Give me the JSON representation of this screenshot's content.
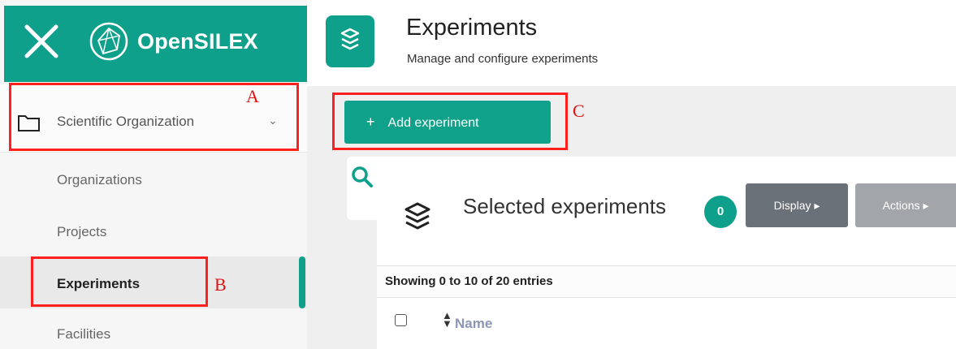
{
  "app": {
    "brand": "OpenSILEX"
  },
  "sidebar": {
    "items": [
      {
        "label": "Scientific Organization",
        "icon": "folder-icon"
      },
      {
        "label": "Organizations"
      },
      {
        "label": "Projects"
      },
      {
        "label": "Experiments",
        "active": true
      },
      {
        "label": "Facilities"
      }
    ]
  },
  "header": {
    "title": "Experiments",
    "subtitle": "Manage and configure experiments"
  },
  "toolbar": {
    "add_label": "Add experiment"
  },
  "panel": {
    "title": "Selected experiments",
    "count": "0",
    "display_label": "Display",
    "actions_label": "Actions",
    "entries": "Showing 0 to 10 of 20 entries",
    "columns": [
      "Name"
    ]
  },
  "annotations": [
    "A",
    "B",
    "C"
  ],
  "colors": {
    "accent": "#0ea08a",
    "annotation": "#ff1f1f"
  }
}
